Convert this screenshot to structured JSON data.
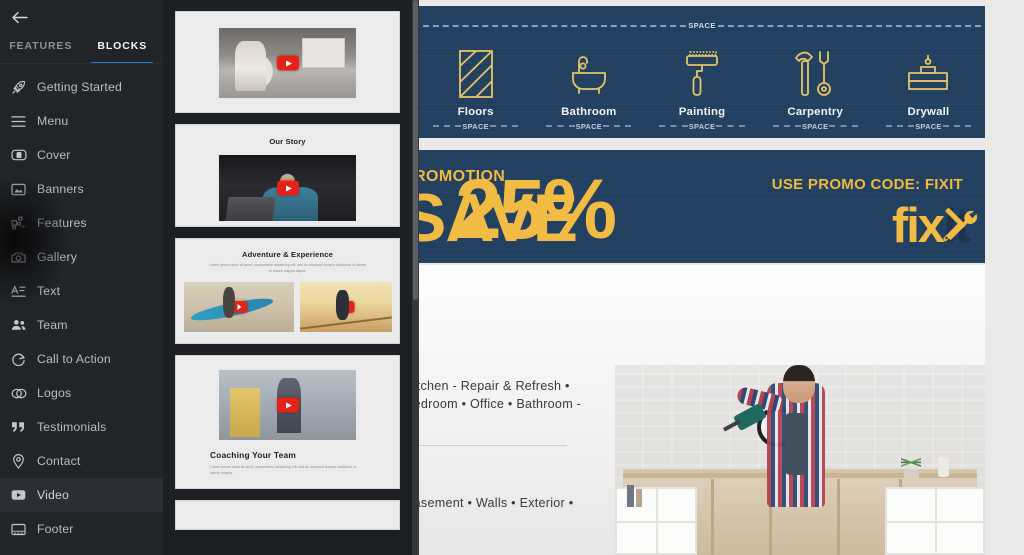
{
  "sidebar": {
    "back_icon": "arrow-left-icon",
    "tabs": [
      {
        "label": "FEATURES",
        "active": false
      },
      {
        "label": "BLOCKS",
        "active": true
      }
    ],
    "items": [
      {
        "label": "Getting Started",
        "icon": "rocket-icon",
        "selected": false
      },
      {
        "label": "Menu",
        "icon": "menu-icon",
        "selected": false
      },
      {
        "label": "Cover",
        "icon": "cover-icon",
        "selected": false
      },
      {
        "label": "Banners",
        "icon": "banner-icon",
        "selected": false
      },
      {
        "label": "Features",
        "icon": "features-grid-icon",
        "selected": false
      },
      {
        "label": "Gallery",
        "icon": "camera-icon",
        "selected": false
      },
      {
        "label": "Text",
        "icon": "text-icon",
        "selected": false
      },
      {
        "label": "Team",
        "icon": "team-icon",
        "selected": false
      },
      {
        "label": "Call to Action",
        "icon": "call-to-action-icon",
        "selected": false
      },
      {
        "label": "Logos",
        "icon": "logos-icon",
        "selected": false
      },
      {
        "label": "Testimonials",
        "icon": "quote-icon",
        "selected": false
      },
      {
        "label": "Contact",
        "icon": "map-pin-icon",
        "selected": false
      },
      {
        "label": "Video",
        "icon": "video-icon",
        "selected": true
      },
      {
        "label": "Footer",
        "icon": "footer-icon",
        "selected": false
      }
    ]
  },
  "blocks_panel": {
    "thumbnails": [
      {
        "name": "video-block-plain",
        "title": "",
        "subtitle": "",
        "play_badge": "youtube-play-icon"
      },
      {
        "name": "video-block-our-story",
        "title": "Our Story",
        "subtitle": "",
        "play_badge": "youtube-play-icon"
      },
      {
        "name": "video-block-adventure",
        "title": "Adventure & Experience",
        "subtitle": "Lorem ipsum dolor sit amet, consectetur adipiscing elit, sed do eiusmod tempor incididunt ut labore et dolore magna aliqua.",
        "play_badge": "youtube-play-icon"
      },
      {
        "name": "video-block-coaching",
        "title": "Coaching Your Team",
        "subtitle": "Lorem ipsum dolor sit amet, consectetur adipiscing elit, sed do eiusmod tempor incididunt ut labore magna.",
        "play_badge": "youtube-play-icon"
      },
      {
        "name": "video-block-next",
        "title": "",
        "subtitle": "",
        "play_badge": ""
      }
    ]
  },
  "canvas": {
    "services_section": {
      "space_label_top": "SPACE",
      "items": [
        {
          "label": "Floors",
          "icon": "floor-tiles-icon",
          "space_label": "SPACE"
        },
        {
          "label": "Bathroom",
          "icon": "bathroom-icon",
          "space_label": "SPACE"
        },
        {
          "label": "Painting",
          "icon": "paint-roller-icon",
          "space_label": "SPACE"
        },
        {
          "label": "Carpentry",
          "icon": "hammer-wrench-icon",
          "space_label": "SPACE"
        },
        {
          "label": "Drywall",
          "icon": "trowel-icon",
          "space_label": "SPACE"
        }
      ]
    },
    "promo_banner": {
      "eyebrow": "PROMOTION",
      "headline_prefix": "SAVE",
      "discount": "25%",
      "promo_code_text": "USE PROMO CODE: FIXIT",
      "logo_part_one": "fix",
      "logo_part_two": "it",
      "logo_icon": "hammer-wrench-crossed-icon",
      "accent_color": "#f2bc44",
      "background_color": "#22405f"
    },
    "content_section": {
      "line_one": "Kitchen - Repair & Refresh •",
      "line_two": "Bedroom • Office • Bathroom -",
      "line_three": "Basement • Walls • Exterior •",
      "photo_alt": "man-using-drill-on-shelf-photo"
    }
  }
}
